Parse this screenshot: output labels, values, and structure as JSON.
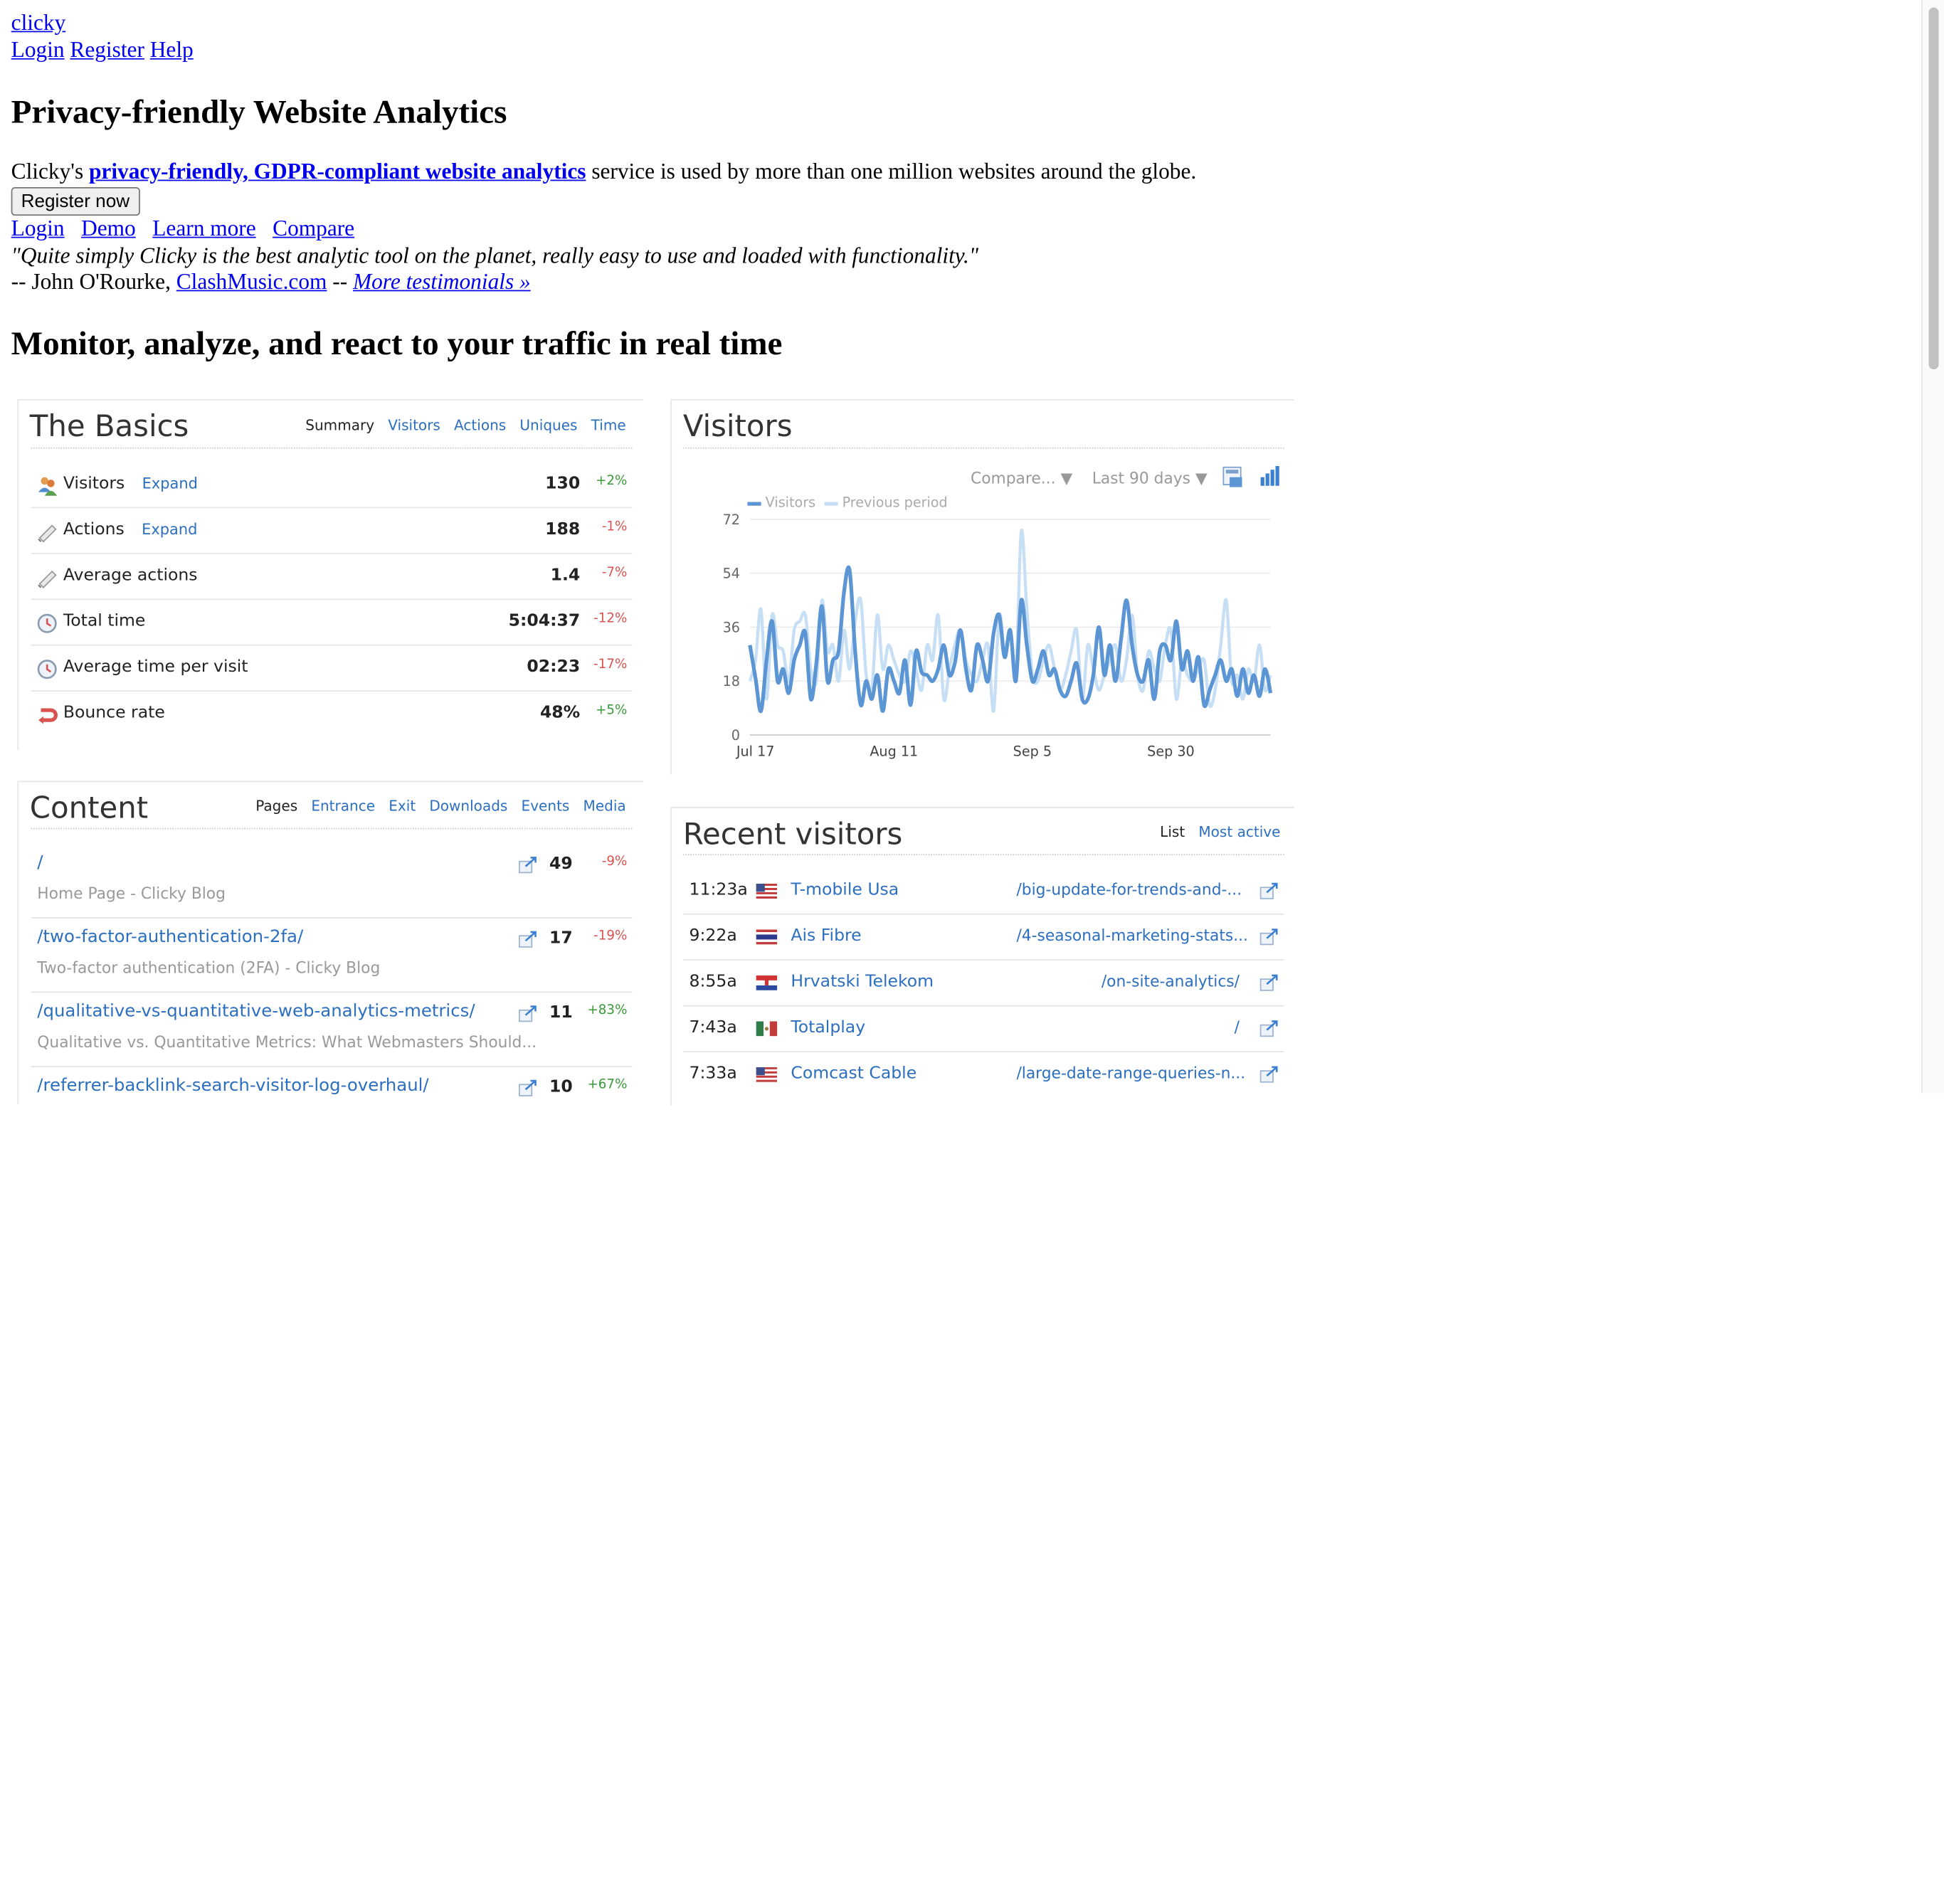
{
  "topnav": {
    "logo": "clicky",
    "links": [
      "Login",
      "Register",
      "Help"
    ]
  },
  "hero": {
    "title": "Privacy-friendly Website Analytics",
    "intro_before": "Clicky's ",
    "intro_link": "privacy-friendly, GDPR-compliant website analytics",
    "intro_after": " service is used by more than one million websites around the globe.",
    "register_button": "Register now",
    "links": [
      "Login",
      "Demo",
      "Learn more",
      "Compare"
    ],
    "quote": "\"Quite simply Clicky is the best analytic tool on the planet, really easy to use and loaded with functionality.\"",
    "attribution_prefix": "-- John O'Rourke, ",
    "attribution_link": "ClashMusic.com",
    "attribution_sep": " -- ",
    "testimonials_link": "More testimonials »"
  },
  "section_title": "Monitor, analyze, and react to your traffic in real time",
  "basics": {
    "title": "The Basics",
    "tabs": [
      "Summary",
      "Visitors",
      "Actions",
      "Uniques",
      "Time"
    ],
    "rows": [
      {
        "icon": "visitors-icon",
        "label": "Visitors",
        "expand": "Expand",
        "value": "130",
        "change": "+2%",
        "trend": "pos"
      },
      {
        "icon": "actions-icon",
        "label": "Actions",
        "expand": "Expand",
        "value": "188",
        "change": "-1%",
        "trend": "neg"
      },
      {
        "icon": "actions-icon",
        "label": "Average actions",
        "expand": "",
        "value": "1.4",
        "change": "-7%",
        "trend": "neg"
      },
      {
        "icon": "clock-icon",
        "label": "Total time",
        "expand": "",
        "value": "5:04:37",
        "change": "-12%",
        "trend": "neg"
      },
      {
        "icon": "clock-icon",
        "label": "Average time per visit",
        "expand": "",
        "value": "02:23",
        "change": "-17%",
        "trend": "neg"
      },
      {
        "icon": "bounce-icon",
        "label": "Bounce rate",
        "expand": "",
        "value": "48%",
        "change": "+5%",
        "trend": "pos"
      }
    ]
  },
  "visitors_card": {
    "title": "Visitors",
    "compare_label": "Compare...",
    "range_label": "Last 90 days",
    "colors": {
      "current": "#5b95d3",
      "previous": "#c7dff5"
    }
  },
  "chart_data": {
    "type": "line",
    "title": "Visitors",
    "xlabel": "",
    "ylabel": "",
    "ylim": [
      0,
      72
    ],
    "yticks": [
      0,
      18,
      36,
      54,
      72
    ],
    "x_tick_labels": [
      "Jul 17",
      "Aug 11",
      "Sep 5",
      "Sep 30"
    ],
    "x_tick_index": [
      1,
      26,
      51,
      76
    ],
    "legend": "top-left",
    "series": [
      {
        "name": "Visitors",
        "values": [
          30,
          19,
          8,
          25,
          38,
          18,
          22,
          14,
          25,
          30,
          34,
          12,
          24,
          43,
          18,
          25,
          28,
          48,
          55,
          28,
          10,
          18,
          12,
          20,
          8,
          22,
          18,
          14,
          25,
          10,
          28,
          21,
          20,
          18,
          22,
          30,
          20,
          24,
          35,
          22,
          15,
          30,
          25,
          18,
          34,
          40,
          26,
          35,
          18,
          45,
          30,
          18,
          22,
          28,
          20,
          22,
          15,
          13,
          18,
          24,
          12,
          12,
          20,
          36,
          20,
          30,
          18,
          32,
          45,
          30,
          20,
          18,
          25,
          12,
          28,
          30,
          25,
          38,
          22,
          28,
          18,
          26,
          10,
          15,
          20,
          25,
          18,
          22,
          13,
          22,
          14,
          20,
          13,
          22,
          14
        ]
      },
      {
        "name": "Previous period",
        "values": [
          18,
          25,
          42,
          12,
          40,
          30,
          28,
          18,
          35,
          38,
          40,
          22,
          18,
          45,
          28,
          30,
          18,
          35,
          22,
          38,
          45,
          20,
          15,
          40,
          22,
          30,
          25,
          20,
          18,
          28,
          22,
          15,
          30,
          25,
          40,
          12,
          22,
          30,
          35,
          25,
          20,
          18,
          25,
          30,
          8,
          40,
          28,
          35,
          20,
          68,
          42,
          20,
          18,
          25,
          30,
          22,
          15,
          20,
          28,
          35,
          12,
          30,
          22,
          15,
          20,
          25,
          30,
          18,
          25,
          40,
          20,
          15,
          28,
          22,
          18,
          30,
          35,
          12,
          25,
          20,
          18,
          22,
          25,
          10,
          15,
          30,
          45,
          18,
          20,
          12,
          22,
          18,
          30,
          15,
          20
        ]
      }
    ]
  },
  "content": {
    "title": "Content",
    "tabs": [
      "Pages",
      "Entrance",
      "Exit",
      "Downloads",
      "Events",
      "Media"
    ],
    "rows": [
      {
        "path": "/",
        "subtitle": "Home Page - Clicky Blog",
        "value": "49",
        "change": "-9%",
        "trend": "neg"
      },
      {
        "path": "/two-factor-authentication-2fa/",
        "subtitle": "Two-factor authentication (2FA) - Clicky Blog",
        "value": "17",
        "change": "-19%",
        "trend": "neg"
      },
      {
        "path": "/qualitative-vs-quantitative-web-analytics-metrics/",
        "subtitle": "Qualitative vs. Quantitative Metrics: What Webmasters Should...",
        "value": "11",
        "change": "+83%",
        "trend": "pos"
      },
      {
        "path": "/referrer-backlink-search-visitor-log-overhaul/",
        "subtitle": "",
        "value": "10",
        "change": "+67%",
        "trend": "pos"
      }
    ]
  },
  "recent": {
    "title": "Recent visitors",
    "tabs": [
      "List",
      "Most active"
    ],
    "rows": [
      {
        "time": "11:23a",
        "flag": "us",
        "org": "T-mobile Usa",
        "page": "/big-update-for-trends-and-..."
      },
      {
        "time": "9:22a",
        "flag": "th",
        "org": "Ais Fibre",
        "page": "/4-seasonal-marketing-stats..."
      },
      {
        "time": "8:55a",
        "flag": "hr",
        "org": "Hrvatski Telekom",
        "page": "/on-site-analytics/"
      },
      {
        "time": "7:43a",
        "flag": "mx",
        "org": "Totalplay",
        "page": "/"
      },
      {
        "time": "7:33a",
        "flag": "us",
        "org": "Comcast Cable",
        "page": "/large-date-range-queries-n..."
      }
    ]
  }
}
